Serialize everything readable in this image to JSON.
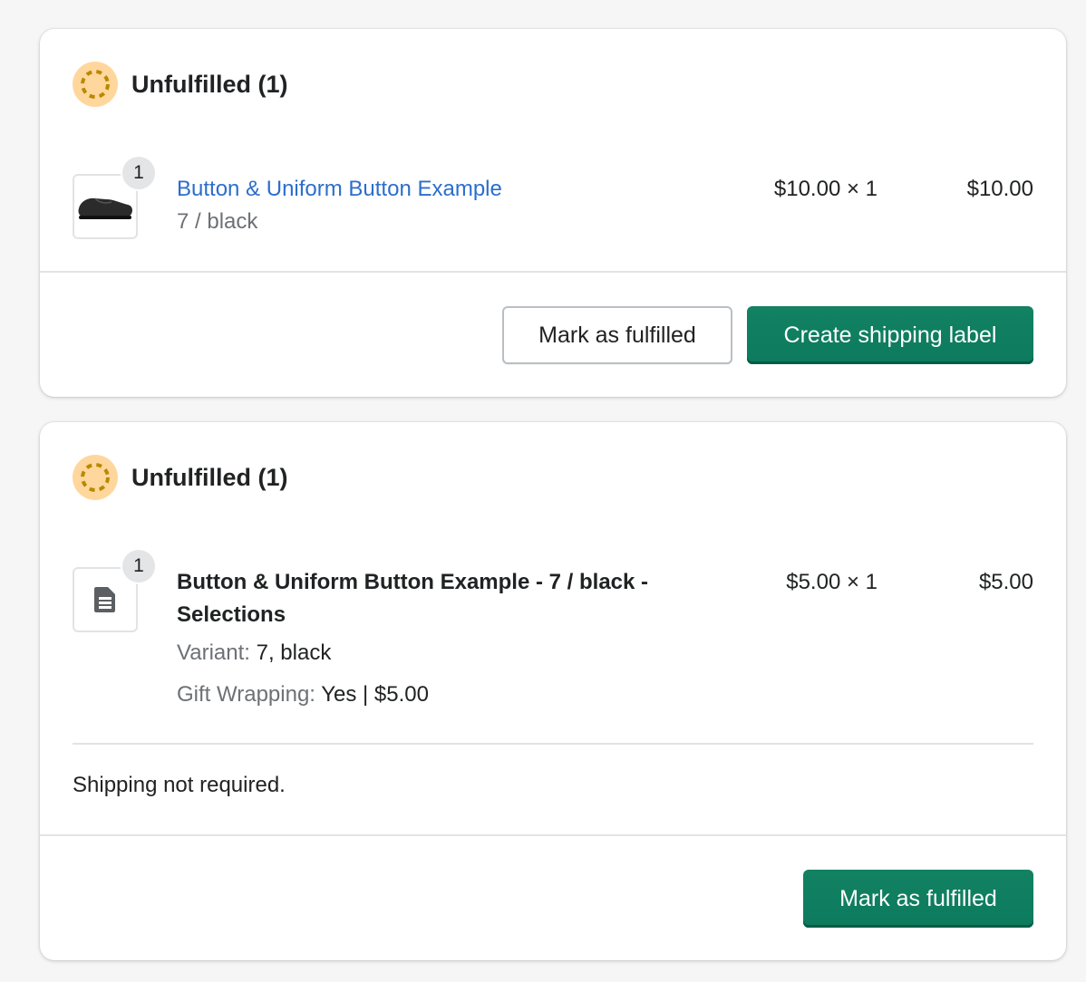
{
  "cards": [
    {
      "status_title": "Unfulfilled (1)",
      "status_icon": "incomplete-circle-icon",
      "item": {
        "quantity_badge": "1",
        "thumbnail": "shoe-thumbnail",
        "title": "Button & Uniform Button Example",
        "variant": "7 / black",
        "unit_price": "$10.00 × 1",
        "total": "$10.00"
      },
      "actions": {
        "secondary_label": "Mark as fulfilled",
        "primary_label": "Create shipping label"
      }
    },
    {
      "status_title": "Unfulfilled (1)",
      "status_icon": "incomplete-circle-icon",
      "item": {
        "quantity_badge": "1",
        "thumbnail": "document-icon",
        "title_line1": "Button & Uniform Button Example - 7 / black -",
        "title_line2": "Selections",
        "variant_label": "Variant:",
        "variant_value": "7, black",
        "gift_label": "Gift Wrapping:",
        "gift_value": "Yes | $5.00",
        "unit_price": "$5.00 × 1",
        "total": "$5.00"
      },
      "shipping_note": "Shipping not required.",
      "actions": {
        "primary_label": "Mark as fulfilled"
      }
    }
  ],
  "colors": {
    "accent_green": "#008060",
    "link_blue": "#2c6ecb",
    "status_bg": "#ffd79d",
    "status_ring": "#b98900"
  }
}
